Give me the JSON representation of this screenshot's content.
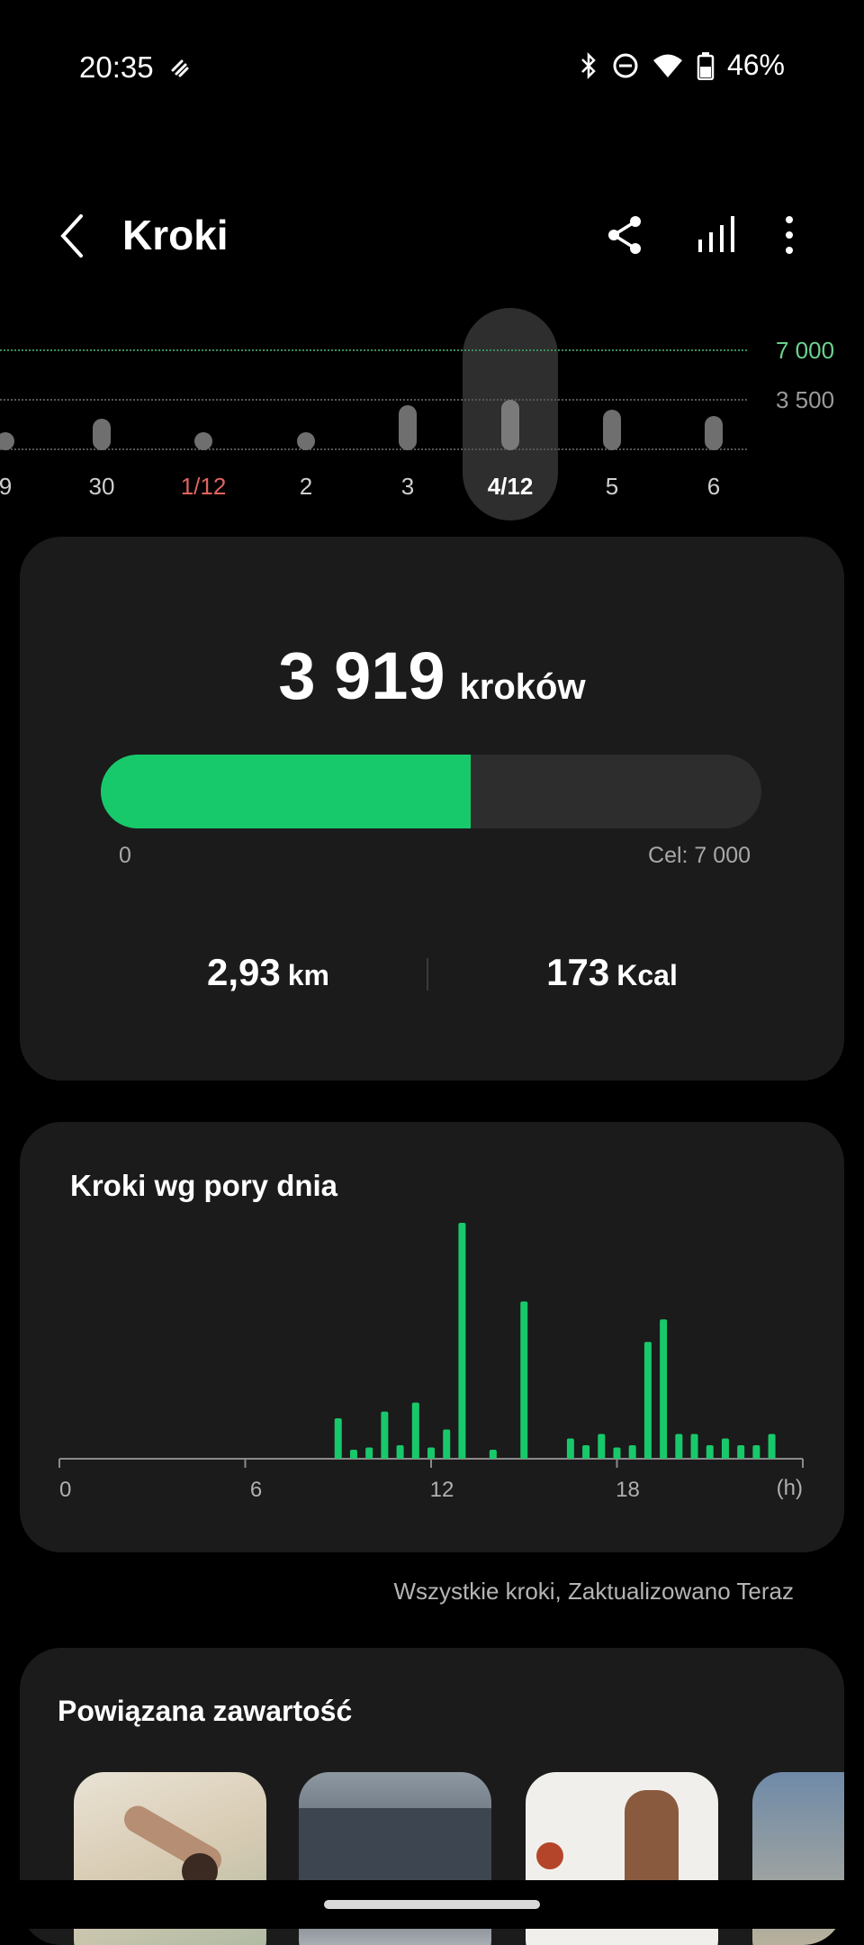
{
  "status_bar": {
    "time": "20:35",
    "battery": "46%",
    "icons": [
      "link-icon",
      "bluetooth-icon",
      "do-not-disturb-icon",
      "wifi-icon",
      "battery-icon"
    ]
  },
  "header": {
    "title": "Kroki",
    "back_icon": "back-chevron-icon",
    "actions": [
      "share-icon",
      "chart-icon",
      "more-icon"
    ]
  },
  "day_strip": {
    "goal_label": "7 000",
    "mid_label": "3 500",
    "goal_color": "#6bd18f",
    "days": [
      {
        "label": "9",
        "fraction": 0.2
      },
      {
        "label": "30",
        "fraction": 0.35
      },
      {
        "label": "1/12",
        "fraction": 0.1,
        "highlight": true
      },
      {
        "label": "2",
        "fraction": 0.2
      },
      {
        "label": "3",
        "fraction": 0.5
      },
      {
        "label": "4/12",
        "fraction": 0.56,
        "selected": true
      },
      {
        "label": "5",
        "fraction": 0.45
      },
      {
        "label": "6",
        "fraction": 0.38
      }
    ],
    "highlight_color": "#e0645f"
  },
  "summary": {
    "steps": "3 919",
    "steps_unit": "kroków",
    "progress_fraction": 0.56,
    "progress_color": "#18c96b",
    "min_label": "0",
    "goal_label": "Cel: 7 000",
    "distance_value": "2,93",
    "distance_unit": "km",
    "calories_value": "173",
    "calories_unit": "Kcal"
  },
  "hourly": {
    "title": "Kroki wg pory dnia",
    "x_ticks": [
      "0",
      "6",
      "12",
      "18"
    ],
    "x_unit": "(h)"
  },
  "chart_data": {
    "type": "bar",
    "title": "Kroki wg pory dnia",
    "xlabel": "(h)",
    "ylabel": "",
    "xlim": [
      0,
      24
    ],
    "x_ticks": [
      0,
      6,
      12,
      18
    ],
    "color": "#18c96b",
    "x": [
      9.0,
      9.5,
      10.0,
      10.5,
      11.0,
      11.5,
      12.0,
      12.5,
      13.0,
      14.0,
      15.0,
      16.5,
      17.0,
      17.5,
      18.0,
      18.5,
      19.0,
      19.5,
      20.0,
      20.5,
      21.0,
      21.5,
      22.0,
      22.5,
      23.0
    ],
    "values": [
      180,
      40,
      50,
      210,
      60,
      250,
      50,
      130,
      1050,
      40,
      700,
      90,
      60,
      110,
      50,
      60,
      520,
      620,
      110,
      110,
      60,
      90,
      60,
      60,
      110
    ]
  },
  "footnote": "Wszystkie kroki, Zaktualizowano Teraz",
  "related": {
    "title": "Powiązana zawartość",
    "items": [
      "workout-thumbnail-1",
      "workout-thumbnail-2",
      "workout-thumbnail-3",
      "workout-thumbnail-4"
    ]
  }
}
